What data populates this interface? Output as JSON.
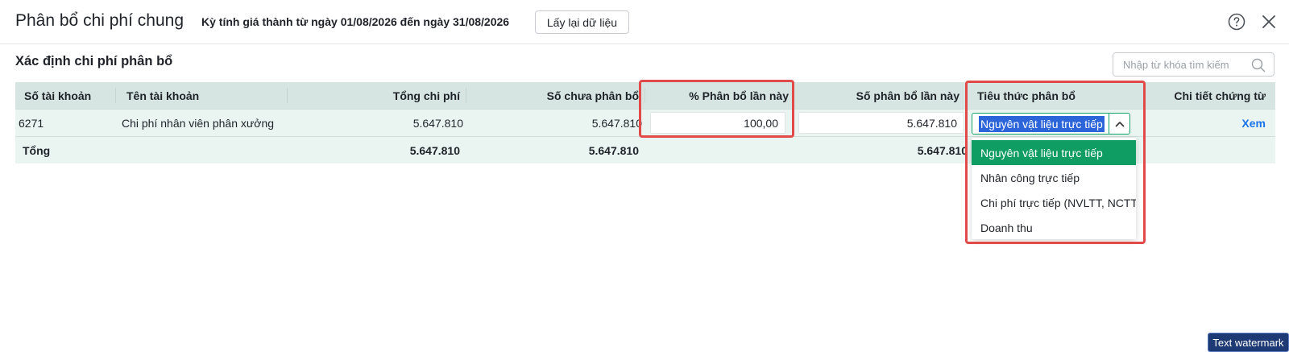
{
  "header": {
    "title": "Phân bổ chi phí chung",
    "period": "Kỳ tính giá thành từ ngày 01/08/2026 đến ngày 31/08/2026",
    "reload_label": "Lấy lại dữ liệu"
  },
  "section": {
    "title": "Xác định chi phí phân bổ",
    "search_placeholder": "Nhập từ khóa tìm kiếm"
  },
  "table": {
    "columns": {
      "account_no": "Số tài khoản",
      "account_name": "Tên tài khoản",
      "total_cost": "Tổng chi phí",
      "unallocated": "Số chưa phân bổ",
      "pct": "% Phân bổ lần này",
      "allocated": "Số phân bổ lần này",
      "criteria": "Tiêu thức phân bổ",
      "detail": "Chi tiết chứng từ"
    },
    "rows": [
      {
        "account_no": "6271",
        "account_name": "Chi phí nhân viên phân xưởng",
        "total_cost": "5.647.810",
        "unallocated": "5.647.810",
        "pct": "100,00",
        "allocated": "5.647.810",
        "criteria": "Nguyên vật liệu trực tiếp",
        "detail": "Xem"
      }
    ],
    "total": {
      "label": "Tổng",
      "total_cost": "5.647.810",
      "unallocated": "5.647.810",
      "allocated": "5.647.810"
    }
  },
  "dropdown": {
    "options": [
      "Nguyên vật liệu trực tiếp",
      "Nhân công trực tiếp",
      "Chi phí trực tiếp (NVLTT, NCTT)",
      "Doanh thu"
    ],
    "selected": "Nguyên vật liệu trực tiếp"
  },
  "watermark": "Text watermark",
  "colors": {
    "header_row": "#d6e5e1",
    "body_row": "#eaf5f2",
    "accent_green": "#0f9d63",
    "highlight_red": "#e24a4a",
    "link_blue": "#1a73e8"
  }
}
